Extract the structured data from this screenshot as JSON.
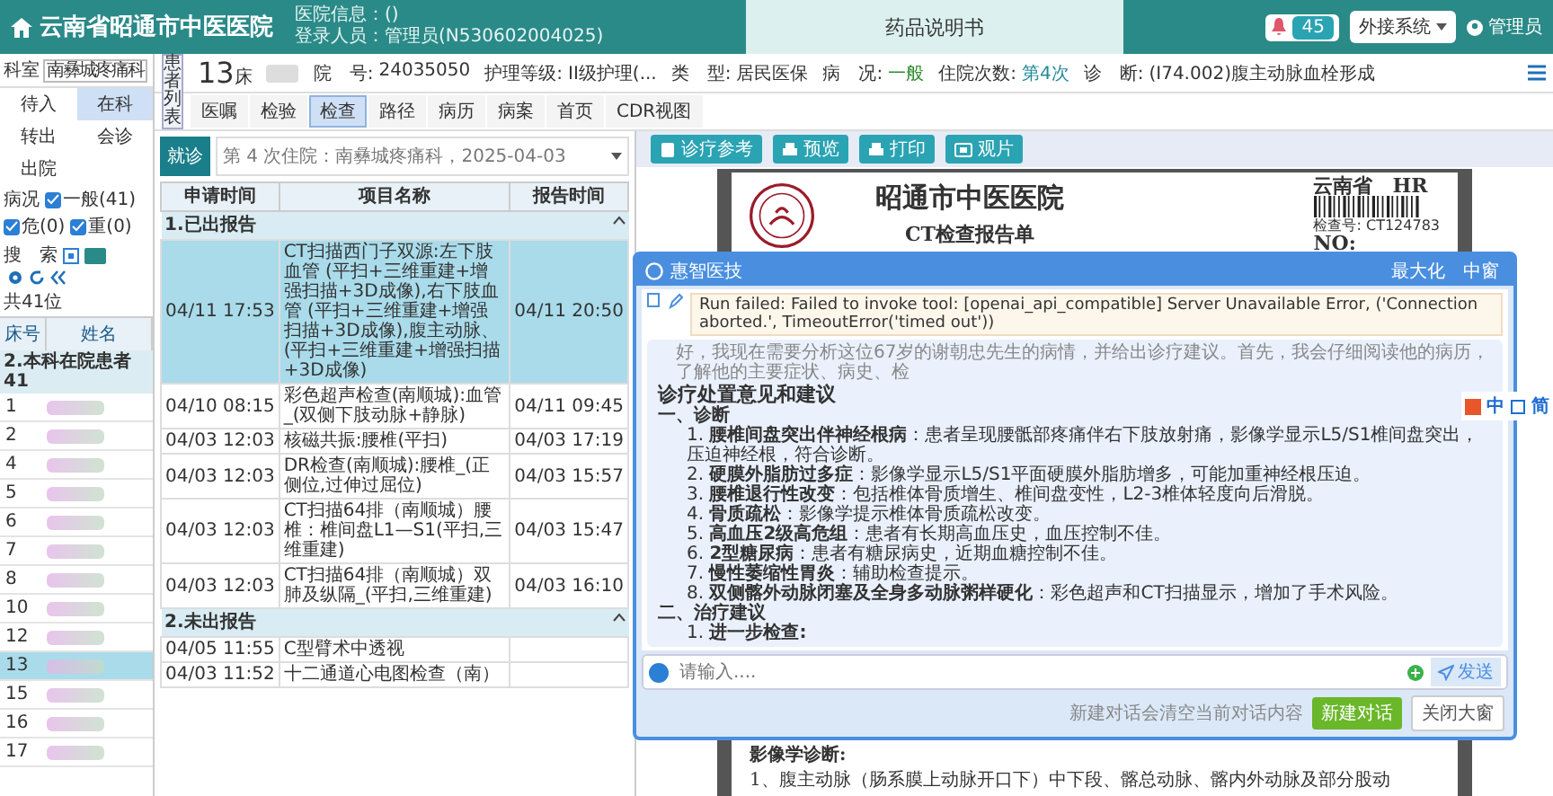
{
  "header": {
    "title": "云南省昭通市中医医院",
    "hospital_info": "医院信息：()",
    "login_user": "登录人员：管理员(N530602004025)",
    "center_tab": "药品说明书",
    "notification_count": "45",
    "external_menu": "外接系统",
    "user": "管理员"
  },
  "patient_bar": {
    "department_label": "科室",
    "department": "南彝城疼痛科",
    "patient_list_tab": "患者列表",
    "bed": "13",
    "bed_unit": "床",
    "fields": [
      {
        "label": "院　号:",
        "value": "24035050",
        "color": "#333333"
      },
      {
        "label": "护理等级:",
        "value": "II级护理(...",
        "color": "#333333"
      },
      {
        "label": "类　型:",
        "value": "居民医保",
        "color": "#333333"
      },
      {
        "label": "病　况:",
        "value": "一般",
        "color": "#2e8b2e"
      },
      {
        "label": "住院次数:",
        "value": "第4次",
        "color": "#1f8a99"
      },
      {
        "label": "诊　断:",
        "value": "(I74.002)腹主动脉血栓形成",
        "color": "#333333"
      }
    ]
  },
  "tabs": [
    {
      "label": "医嘱",
      "selected": false
    },
    {
      "label": "检验",
      "selected": false
    },
    {
      "label": "检查",
      "selected": true
    },
    {
      "label": "路径",
      "selected": false
    },
    {
      "label": "病历",
      "selected": false
    },
    {
      "label": "病案",
      "selected": false
    },
    {
      "label": "首页",
      "selected": false
    },
    {
      "label": "CDR视图",
      "selected": false
    }
  ],
  "sidebar": {
    "status_buttons": [
      {
        "label": "待入",
        "selected": false
      },
      {
        "label": "在科",
        "selected": true
      },
      {
        "label": "转出",
        "selected": false
      },
      {
        "label": "会诊",
        "selected": false
      },
      {
        "label": "出院",
        "selected": false
      }
    ],
    "condition_label": "病况",
    "conditions": [
      {
        "label": "一般(41)",
        "checked": true
      },
      {
        "label": "危(0)",
        "checked": true
      },
      {
        "label": "重(0)",
        "checked": true
      }
    ],
    "search_label": "搜　索",
    "count": "共41位",
    "patient_table": {
      "columns": [
        "床号",
        "姓名"
      ],
      "group": "2.本科在院患者 41",
      "rows": [
        {
          "bed": "1",
          "selected": false
        },
        {
          "bed": "2",
          "selected": false
        },
        {
          "bed": "4",
          "selected": false
        },
        {
          "bed": "5",
          "selected": false
        },
        {
          "bed": "6",
          "selected": false
        },
        {
          "bed": "7",
          "selected": false
        },
        {
          "bed": "8",
          "selected": false
        },
        {
          "bed": "10",
          "selected": false
        },
        {
          "bed": "12",
          "selected": false
        },
        {
          "bed": "13",
          "selected": true
        },
        {
          "bed": "15",
          "selected": false
        },
        {
          "bed": "16",
          "selected": false
        },
        {
          "bed": "17",
          "selected": false
        }
      ]
    }
  },
  "visit": {
    "button": "就诊",
    "selection": "第 4 次住院：南彝城疼痛科，2025-04-03"
  },
  "report_table": {
    "columns": [
      "申请时间",
      "项目名称",
      "报告时间"
    ],
    "groups": [
      {
        "title": "1.已出报告",
        "expanded": true,
        "rows": [
          {
            "requested": "04/11 17:53",
            "item": "CT扫描西门子双源:左下肢血管 (平扫+三维重建+增强扫描+3D成像),右下肢血管 (平扫+三维重建+增强扫描+3D成像),腹主动脉、(平扫+三维重建+增强扫描+3D成像)",
            "reported": "04/11 20:50",
            "selected": true
          },
          {
            "requested": "04/10 08:15",
            "item": "彩色超声检查(南顺城):血管_(双侧下肢动脉+静脉)",
            "reported": "04/11 09:45",
            "selected": false
          },
          {
            "requested": "04/03 12:03",
            "item": "核磁共振:腰椎(平扫)",
            "reported": "04/03 17:19",
            "selected": false
          },
          {
            "requested": "04/03 12:03",
            "item": "DR检查(南顺城):腰椎_(正侧位,过伸过屈位)",
            "reported": "04/03 15:57",
            "selected": false
          },
          {
            "requested": "04/03 12:03",
            "item": "CT扫描64排（南顺城）腰椎：椎间盘L1—S1(平扫,三维重建)",
            "reported": "04/03 15:47",
            "selected": false
          },
          {
            "requested": "04/03 12:03",
            "item": "CT扫描64排（南顺城）双肺及纵隔_(平扫,三维重建)",
            "reported": "04/03 16:10",
            "selected": false
          }
        ]
      },
      {
        "title": "2.未出报告",
        "expanded": true,
        "rows": [
          {
            "requested": "04/05 11:55",
            "item": "C型臂术中透视",
            "reported": "",
            "selected": false
          },
          {
            "requested": "04/03 11:52",
            "item": "十二通道心电图检查（南）",
            "reported": "",
            "selected": false
          }
        ]
      }
    ]
  },
  "report_toolbar": [
    {
      "label": "诊疗参考",
      "kind": "reference"
    },
    {
      "label": "预览",
      "kind": "print"
    },
    {
      "label": "打印",
      "kind": "print"
    },
    {
      "label": "观片",
      "kind": "film"
    }
  ],
  "document": {
    "hospital": "昭通市中医医院",
    "title": "CT检查报告单",
    "region": "云南省　HR",
    "exam_no_label": "检查号:",
    "exam_no": "CT124783",
    "no_label": "NO:",
    "section": "影像学诊断:",
    "line": "1、腹主动脉（肠系膜上动脉开口下）中下段、髂总动脉、髂内外动脉及部分股动"
  },
  "assistant": {
    "title": "惠智医技",
    "maximize": "最大化",
    "medium": "中窗",
    "error": "Run failed: Failed to invoke tool: [openai_api_compatible] Server Unavailable Error, ('Connection aborted.', TimeoutError('timed out'))",
    "thinking": "好，我现在需要分析这位67岁的谢朝忠先生的病情，并给出诊疗建议。首先，我会仔细阅读他的病历，了解他的主要症状、病史、检",
    "heading": "诊疗处置意见和建议",
    "sections": [
      {
        "title": "一、诊断",
        "items": [
          {
            "number": "1.",
            "term": "腰椎间盘突出伴神经根病",
            "text": "：患者呈现腰骶部疼痛伴右下肢放射痛，影像学显示L5/S1椎间盘突出，压迫神经根，符合诊断。"
          },
          {
            "number": "2.",
            "term": "硬膜外脂肪过多症",
            "text": "：影像学显示L5/S1平面硬膜外脂肪增多，可能加重神经根压迫。"
          },
          {
            "number": "3.",
            "term": "腰椎退行性改变",
            "text": "：包括椎体骨质增生、椎间盘变性，L2-3椎体轻度向后滑脱。"
          },
          {
            "number": "4.",
            "term": "骨质疏松",
            "text": "：影像学提示椎体骨质疏松改变。"
          },
          {
            "number": "5.",
            "term": "高血压2级高危组",
            "text": "：患者有长期高血压史，血压控制不佳。"
          },
          {
            "number": "6.",
            "term": "2型糖尿病",
            "text": "：患者有糖尿病史，近期血糖控制不佳。"
          },
          {
            "number": "7.",
            "term": "慢性萎缩性胃炎",
            "text": "：辅助检查提示。"
          },
          {
            "number": "8.",
            "term": "双侧髂外动脉闭塞及全身多动脉粥样硬化",
            "text": "：彩色超声和CT扫描显示，增加了手术风险。"
          }
        ]
      },
      {
        "title": "二、治疗建议",
        "items": [
          {
            "number": "1.",
            "term": "进一步检查:"
          }
        ]
      }
    ],
    "input_placeholder": "请输入....",
    "send": "发送",
    "footer_note": "新建对话会清空当前对话内容",
    "new_chat": "新建对话",
    "close": "关闭大窗"
  },
  "ime_toolbar": {
    "mode": "中",
    "variant": "简"
  }
}
